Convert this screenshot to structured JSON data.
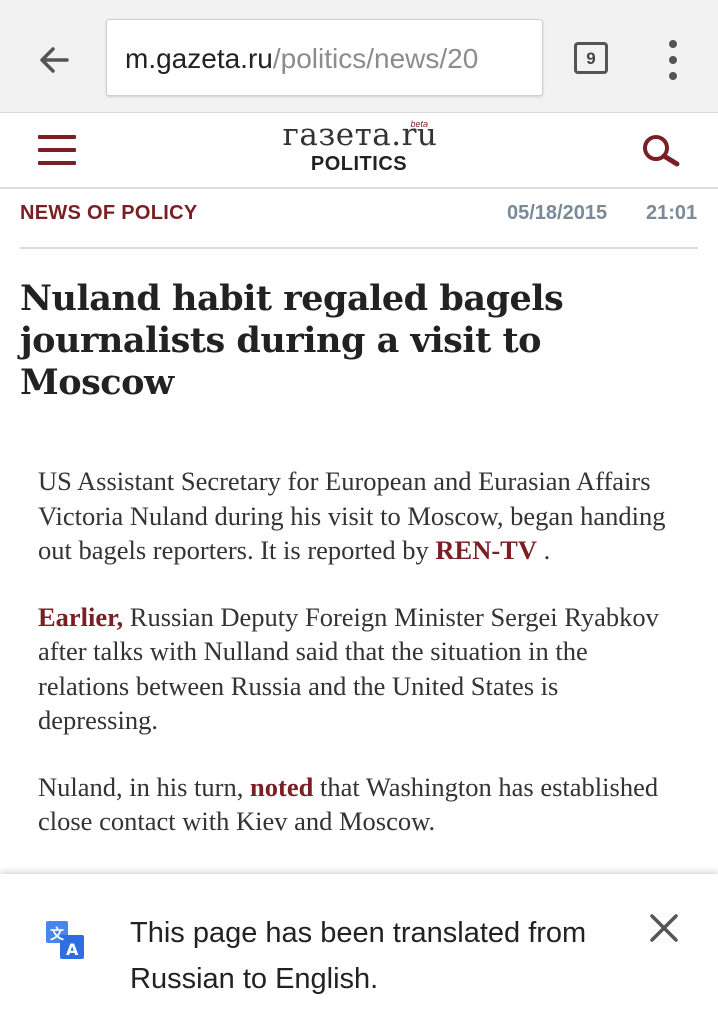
{
  "browser": {
    "url_host": "m.gazeta.ru",
    "url_path": "/politics/news/20",
    "tab_count": "9"
  },
  "site": {
    "logo_text": "газета.ru",
    "logo_badge": "beta",
    "section": "POLITICS"
  },
  "article": {
    "category": "NEWS OF POLICY",
    "date": "05/18/2015",
    "time": "21:01",
    "headline": "Nuland habit regaled bagels journalists during a visit to Moscow",
    "p1_text": "US Assistant Secretary for European and Eurasian Affairs Victoria Nuland during his visit to Moscow, began handing out bagels reporters. It is reported by ",
    "p1_link": "REN-TV",
    "p1_end": " .",
    "p2_link": "Earlier,",
    "p2_text": " Russian Deputy Foreign Minister Sergei Ryabkov after talks with Nulland said that the situation in the relations between Russia and the United States is depressing.",
    "p3_start": "Nuland, in his turn, ",
    "p3_link": "noted",
    "p3_text": " that Washington has established close contact with Kiev and Moscow."
  },
  "translate": {
    "message": "This page has been translated from Russian to English."
  },
  "icons": {
    "back": "arrow-back-icon",
    "menu": "more-vert-icon",
    "hamburger": "hamburger-icon",
    "search": "search-icon",
    "translate": "translate-icon",
    "close": "close-icon"
  },
  "colors": {
    "brand": "#7a1f23",
    "meta_gray": "#7b8a96",
    "translate_blue": "#4a86e8"
  }
}
